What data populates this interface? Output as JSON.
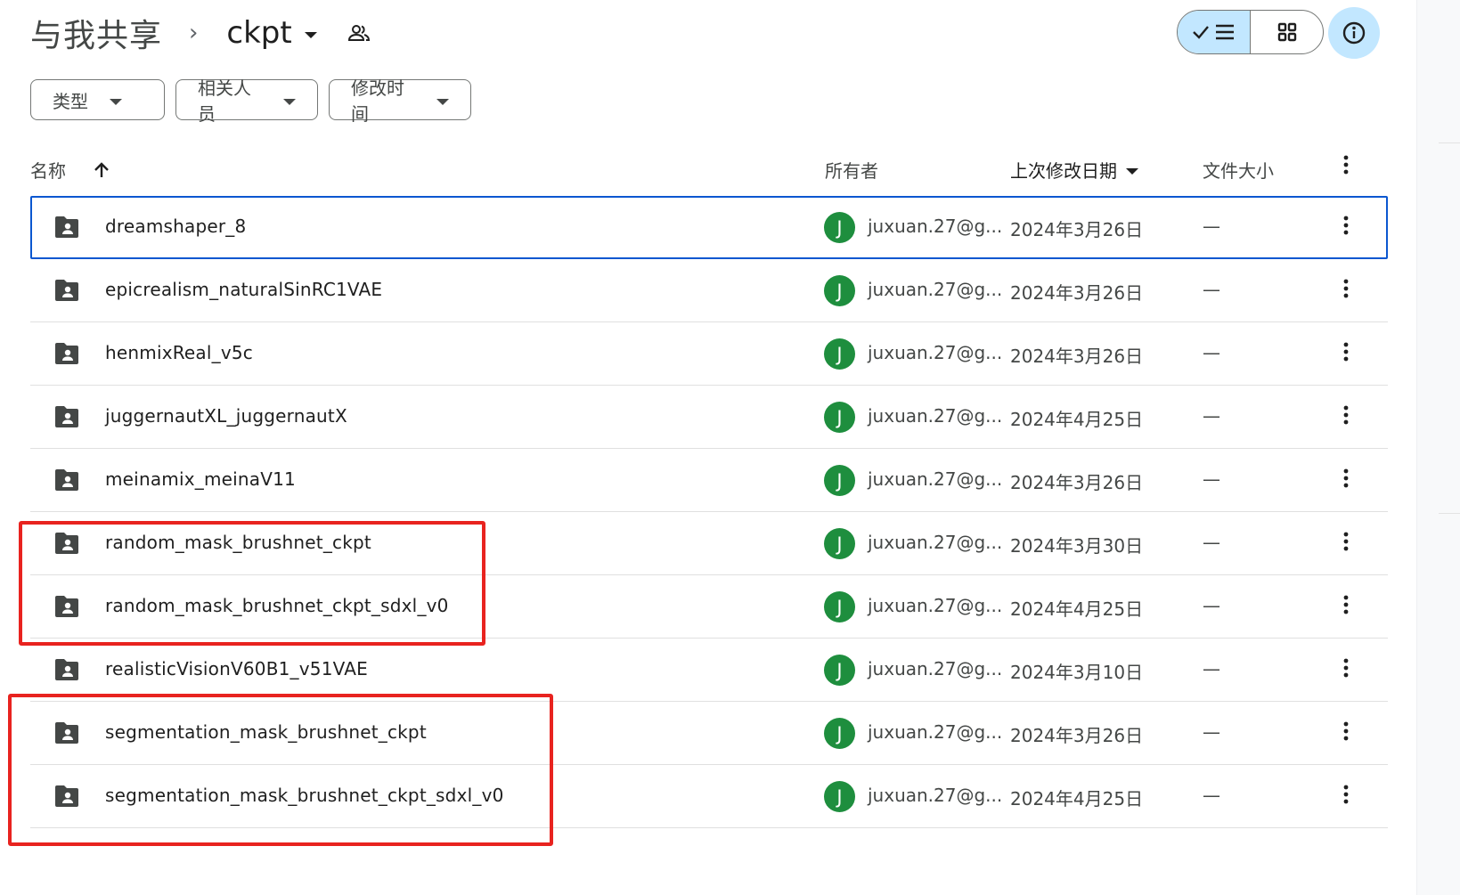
{
  "header": {
    "root_label": "与我共享",
    "separator": "›",
    "current_folder": "ckpt",
    "shared_icon": "people-outline-icon",
    "view_list_icon": "check-list-icon",
    "view_grid_icon": "grid-icon",
    "info_icon": "info-icon"
  },
  "filters": [
    {
      "label": "类型"
    },
    {
      "label": "相关人员"
    },
    {
      "label": "修改时间"
    }
  ],
  "columns": {
    "name": "名称",
    "owner": "所有者",
    "modified": "上次修改日期",
    "size": "文件大小"
  },
  "rows": [
    {
      "name": "dreamshaper_8",
      "avatar": "J",
      "owner": "juxuan.27@g...",
      "modified": "2024年3月26日",
      "size": "—",
      "selected": true
    },
    {
      "name": "epicrealism_naturalSinRC1VAE",
      "avatar": "J",
      "owner": "juxuan.27@g...",
      "modified": "2024年3月26日",
      "size": "—"
    },
    {
      "name": "henmixReal_v5c",
      "avatar": "J",
      "owner": "juxuan.27@g...",
      "modified": "2024年3月26日",
      "size": "—"
    },
    {
      "name": "juggernautXL_juggernautX",
      "avatar": "J",
      "owner": "juxuan.27@g...",
      "modified": "2024年4月25日",
      "size": "—"
    },
    {
      "name": "meinamix_meinaV11",
      "avatar": "J",
      "owner": "juxuan.27@g...",
      "modified": "2024年3月26日",
      "size": "—"
    },
    {
      "name": "random_mask_brushnet_ckpt",
      "avatar": "J",
      "owner": "juxuan.27@g...",
      "modified": "2024年3月30日",
      "size": "—"
    },
    {
      "name": "random_mask_brushnet_ckpt_sdxl_v0",
      "avatar": "J",
      "owner": "juxuan.27@g...",
      "modified": "2024年4月25日",
      "size": "—"
    },
    {
      "name": "realisticVisionV60B1_v51VAE",
      "avatar": "J",
      "owner": "juxuan.27@g...",
      "modified": "2024年3月10日",
      "size": "—"
    },
    {
      "name": "segmentation_mask_brushnet_ckpt",
      "avatar": "J",
      "owner": "juxuan.27@g...",
      "modified": "2024年3月26日",
      "size": "—"
    },
    {
      "name": "segmentation_mask_brushnet_ckpt_sdxl_v0",
      "avatar": "J",
      "owner": "juxuan.27@g...",
      "modified": "2024年4月25日",
      "size": "—"
    }
  ],
  "colors": {
    "accent": "#c2e7ff",
    "selection_border": "#0b57d0",
    "avatar": "#1e8e3e",
    "annotation": "#e8231f"
  }
}
